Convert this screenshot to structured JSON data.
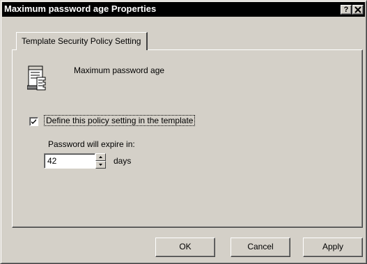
{
  "window": {
    "title": "Maximum password age Properties",
    "help_label": "?",
    "close_label": "✕"
  },
  "tabs": [
    {
      "label": "Template Security Policy Setting",
      "selected": true
    }
  ],
  "policy": {
    "icon": "policy-scroll-icon",
    "name": "Maximum password age"
  },
  "define_setting": {
    "label": "Define this policy setting in the template",
    "checked": true
  },
  "expire": {
    "label": "Password will expire in:",
    "value": "42",
    "unit": "days"
  },
  "buttons": {
    "ok": "OK",
    "cancel": "Cancel",
    "apply": "Apply"
  }
}
